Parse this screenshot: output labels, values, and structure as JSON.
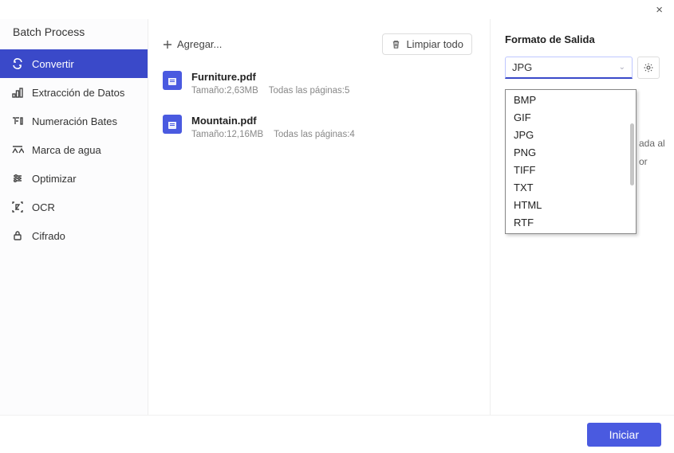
{
  "window": {
    "title": "Batch Process"
  },
  "sidebar": {
    "items": [
      {
        "label": "Convertir"
      },
      {
        "label": "Extracción de Datos"
      },
      {
        "label": "Numeración Bates"
      },
      {
        "label": "Marca de agua"
      },
      {
        "label": "Optimizar"
      },
      {
        "label": "OCR"
      },
      {
        "label": "Cifrado"
      }
    ]
  },
  "toolbar": {
    "add_label": "Agregar...",
    "clear_label": "Limpiar todo"
  },
  "files": [
    {
      "name": "Furniture.pdf",
      "size_label": "Tamaño:2,63MB",
      "pages_label": "Todas las páginas:5"
    },
    {
      "name": "Mountain.pdf",
      "size_label": "Tamaño:12,16MB",
      "pages_label": "Todas las páginas:4"
    }
  ],
  "output": {
    "section_title": "Formato de Salida",
    "selected": "JPG",
    "options": [
      "BMP",
      "GIF",
      "JPG",
      "PNG",
      "TIFF",
      "TXT",
      "HTML",
      "RTF"
    ],
    "obscured_text_1": "ada al",
    "obscured_text_2": "or"
  },
  "footer": {
    "start_label": "Iniciar"
  }
}
